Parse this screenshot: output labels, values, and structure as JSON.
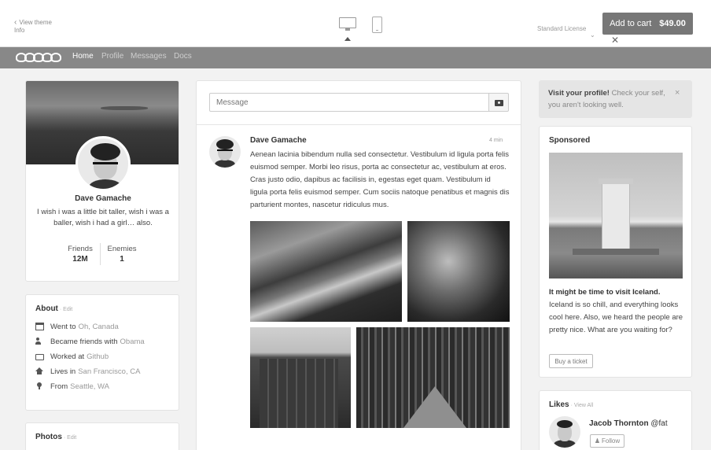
{
  "preview_bar": {
    "view_theme": "View theme",
    "info": "Info",
    "license": "Standard License",
    "cart_label": "Add to cart",
    "cart_price": "$49.00"
  },
  "nav": {
    "links": [
      "Home",
      "Profile",
      "Messages",
      "Docs"
    ]
  },
  "profile": {
    "name": "Dave Gamache",
    "bio": "I wish i was a little bit taller, wish i was a baller, wish i had a girl… also.",
    "stats": [
      {
        "label": "Friends",
        "value": "12M"
      },
      {
        "label": "Enemies",
        "value": "1"
      }
    ]
  },
  "about": {
    "title": "About",
    "edit": "· Edit",
    "items": [
      {
        "icon": "calendar-icon",
        "text": "Went to",
        "link": "Oh, Canada"
      },
      {
        "icon": "users-icon",
        "text": "Became friends with",
        "link": "Obama"
      },
      {
        "icon": "briefcase-icon",
        "text": "Worked at",
        "link": "Github"
      },
      {
        "icon": "home-icon",
        "text": "Lives in",
        "link": "San Francisco, CA"
      },
      {
        "icon": "map-pin-icon",
        "text": "From",
        "link": "Seattle, WA"
      }
    ]
  },
  "photos": {
    "title": "Photos",
    "edit": "· Edit"
  },
  "composer": {
    "placeholder": "Message"
  },
  "post": {
    "author": "Dave Gamache",
    "time": "4 min",
    "text": "Aenean lacinia bibendum nulla sed consectetur. Vestibulum id ligula porta felis euismod semper. Morbi leo risus, porta ac consectetur ac, vestibulum at eros. Cras justo odio, dapibus ac facilisis in, egestas eget quam. Vestibulum id ligula porta felis euismod semper. Cum sociis natoque penatibus et magnis dis parturient montes, nascetur ridiculus mus."
  },
  "alert": {
    "bold": "Visit your profile!",
    "text": " Check your self, you aren't looking well.",
    "close": "×"
  },
  "sponsored": {
    "title": "Sponsored",
    "headline": "It might be time to visit Iceland.",
    "text": "Iceland is so chill, and everything looks cool here. Also, we heard the people are pretty nice. What are you waiting for?",
    "button": "Buy a ticket"
  },
  "likes": {
    "title": "Likes",
    "view_all": "· View All",
    "name": "Jacob Thornton",
    "handle": " @fat",
    "follow": "Follow"
  }
}
